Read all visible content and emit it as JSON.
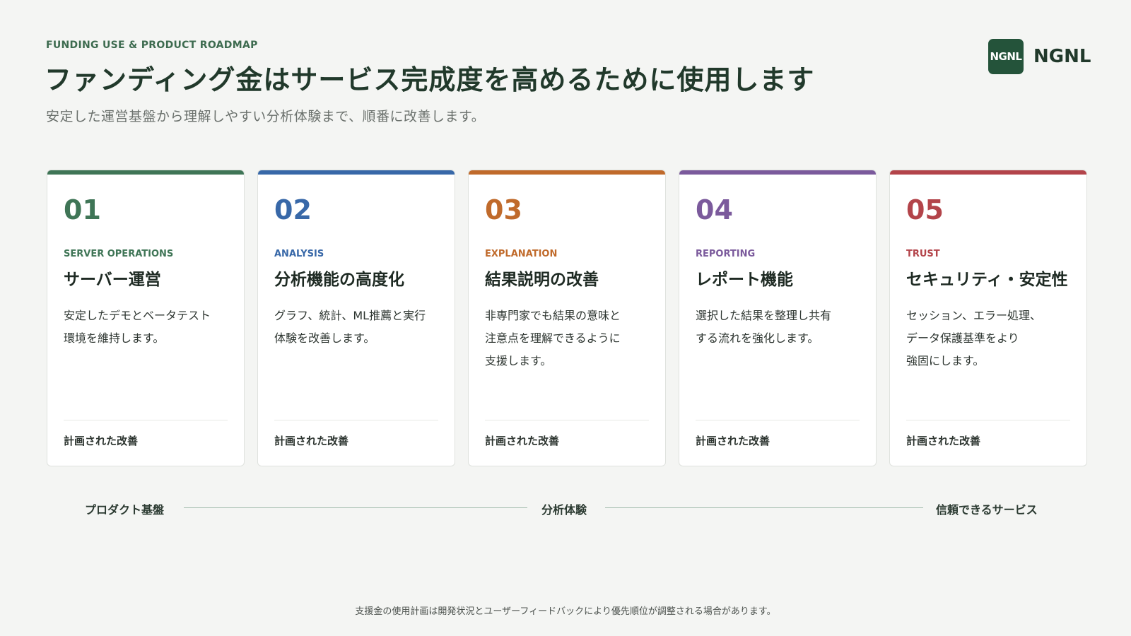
{
  "header": {
    "kicker": "FUNDING USE & PRODUCT ROADMAP",
    "title": "ファンディング金はサービス完成度を高めるために使用します",
    "subtitle": "安定した運営基盤から理解しやすい分析体験まで、順番に改善します。"
  },
  "logo": {
    "mark": "NGNL",
    "text": "NGNL",
    "color": "#24533a"
  },
  "cards": [
    {
      "number": "01",
      "tag": "SERVER OPERATIONS",
      "title": "サーバー運営",
      "desc": [
        "安定したデモとベータテスト",
        "環境を維持します。"
      ],
      "status": "計画された改善",
      "color": "#3f7556"
    },
    {
      "number": "02",
      "tag": "ANALYSIS",
      "title": "分析機能の高度化",
      "desc": [
        "グラフ、統計、ML推薦と実行",
        "体験を改善します。"
      ],
      "status": "計画された改善",
      "color": "#3868a8"
    },
    {
      "number": "03",
      "tag": "EXPLANATION",
      "title": "結果説明の改善",
      "desc": [
        "非専門家でも結果の意味と",
        "注意点を理解できるように",
        "支援します。"
      ],
      "status": "計画された改善",
      "color": "#c06a2b"
    },
    {
      "number": "04",
      "tag": "REPORTING",
      "title": "レポート機能",
      "desc": [
        "選択した結果を整理し共有",
        "する流れを強化します。"
      ],
      "status": "計画された改善",
      "color": "#7b5a9c"
    },
    {
      "number": "05",
      "tag": "TRUST",
      "title": "セキュリティ・安定性",
      "desc": [
        "セッション、エラー処理、",
        "データ保護基準をより",
        "強固にします。"
      ],
      "status": "計画された改善",
      "color": "#b3444a"
    }
  ],
  "timeline": {
    "start": "プロダクト基盤",
    "middle": "分析体験",
    "end": "信頼できるサービス"
  },
  "footnote": "支援金の使用計画は開発状況とユーザーフィードバックにより優先順位が調整される場合があります。"
}
